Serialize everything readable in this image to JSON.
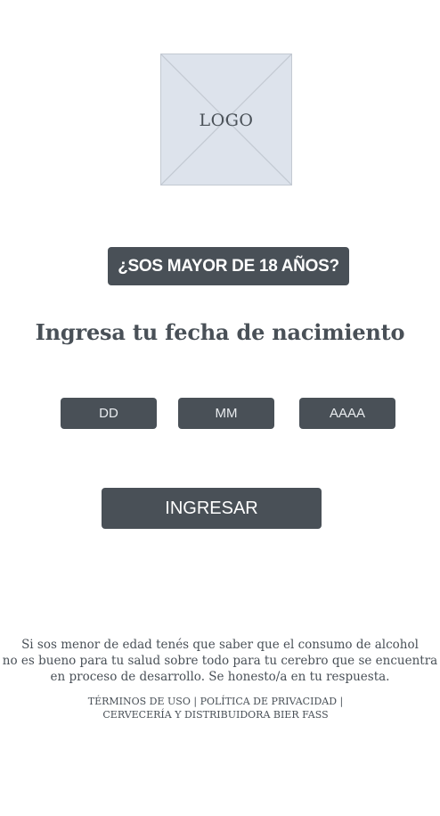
{
  "logo": {
    "label": "LOGO"
  },
  "age_question": "¿SOS MAYOR DE 18 AÑOS?",
  "heading": "Ingresa tu fecha de nacimiento",
  "date_fields": {
    "day_placeholder": "DD",
    "month_placeholder": "MM",
    "year_placeholder": "AAAA"
  },
  "submit_label": "INGRESAR",
  "disclaimer": {
    "line1": "Si sos menor de edad tenés que saber que el consumo de alcohol",
    "line2": "no es bueno para tu salud sobre todo para tu cerebro que se encuentra",
    "line3": "en proceso de desarrollo. Se honesto/a en tu respuesta."
  },
  "footer": {
    "terms": "TÉRMINOS DE USO",
    "privacy": "POLÍTICA DE PRIVACIDAD",
    "separator": "|",
    "brand": "CERVECERÍA Y DISTRIBUIDORA BIER FASS"
  },
  "colors": {
    "primary": "#495057",
    "placeholder_bg": "#dde3ec",
    "background": "#ffffff"
  }
}
